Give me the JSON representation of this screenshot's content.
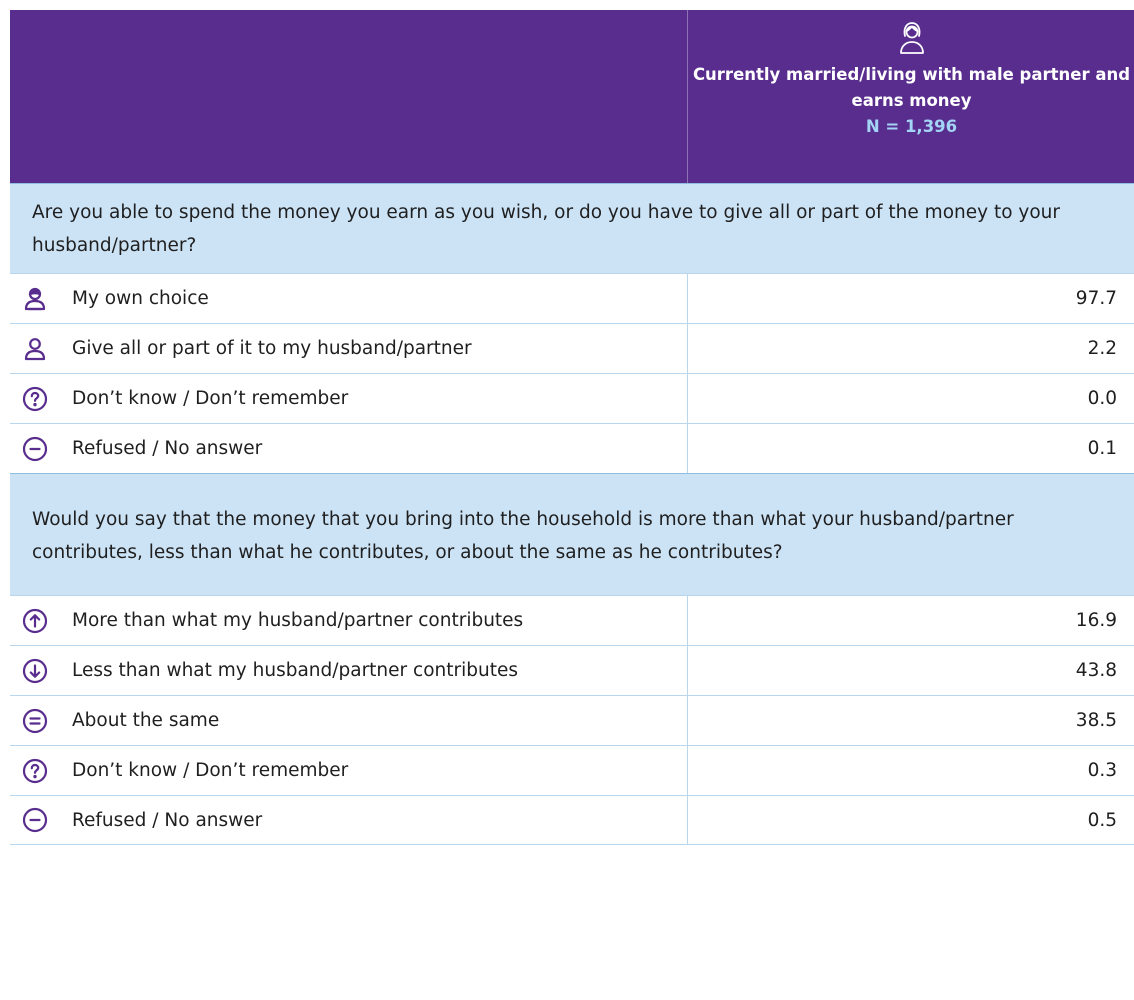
{
  "header": {
    "icon": "woman-icon",
    "column_title": "Currently married/living with male partner and earns money",
    "n_label": "N = 1,396",
    "colors": {
      "header_bg": "#582d8e",
      "n_text": "#a3d3f5",
      "question_bg": "#cce3f6",
      "icon": "#582d8e"
    }
  },
  "sections": [
    {
      "question": "Are you able to spend the money you earn as you wish, or do you have to give all or part of the money to your husband/partner?",
      "rows": [
        {
          "icon": "woman-person-icon",
          "label": "My own choice",
          "value": "97.7"
        },
        {
          "icon": "person-icon",
          "label": "Give all or part of it to my husband/partner",
          "value": "2.2"
        },
        {
          "icon": "question-circle-icon",
          "label": "Don’t know / Don’t remember",
          "value": "0.0"
        },
        {
          "icon": "minus-circle-icon",
          "label": "Refused / No answer",
          "value": "0.1"
        }
      ]
    },
    {
      "question": "Would you say that the money that you bring into the household is more than what your husband/partner contributes, less than what he contributes, or about the same as he contributes?",
      "rows": [
        {
          "icon": "arrow-up-circle-icon",
          "label": "More than what my husband/partner contributes",
          "value": "16.9"
        },
        {
          "icon": "arrow-down-circle-icon",
          "label": "Less than what my husband/partner contributes",
          "value": "43.8"
        },
        {
          "icon": "equals-circle-icon",
          "label": "About the same",
          "value": "38.5"
        },
        {
          "icon": "question-circle-icon",
          "label": "Don’t know / Don’t remember",
          "value": "0.3"
        },
        {
          "icon": "minus-circle-icon",
          "label": "Refused / No answer",
          "value": "0.5"
        }
      ]
    }
  ]
}
